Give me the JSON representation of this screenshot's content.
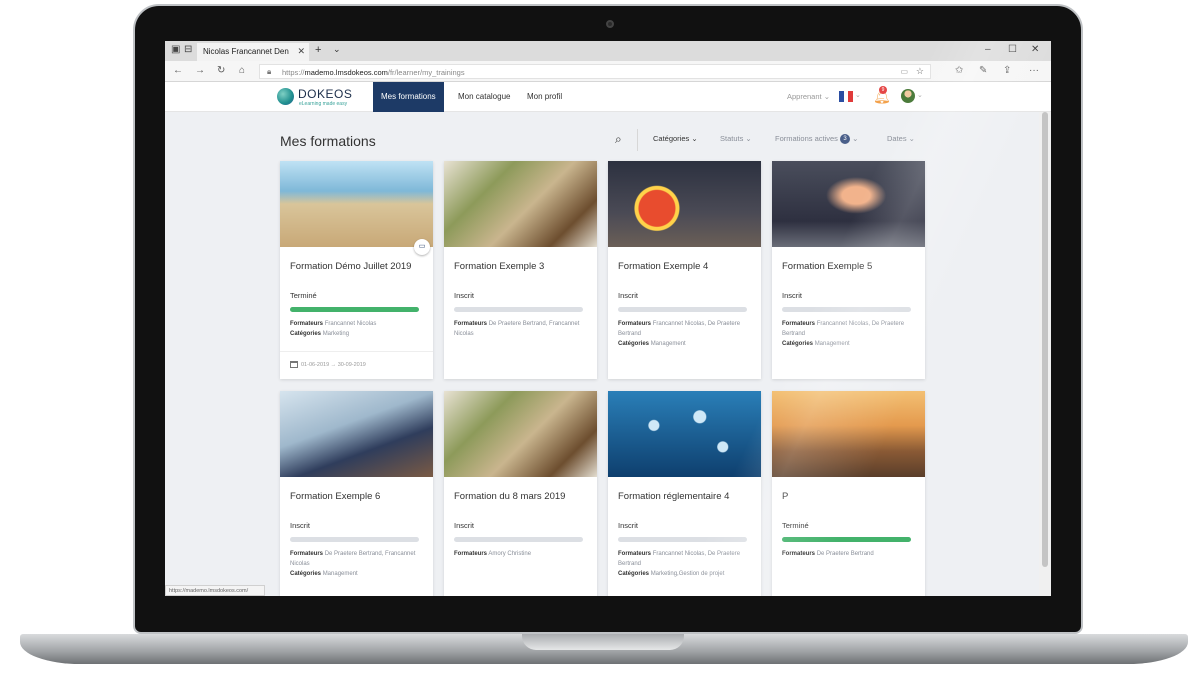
{
  "browser": {
    "tab_title": "Nicolas Francannet Den",
    "tab_close": "✕",
    "new_tab": "+",
    "tab_menu": "⌄",
    "url_prefix": "https://",
    "url_host": "mademo.lmsdokeos.com",
    "url_path": "/fr/learner/my_trainings",
    "status_url": "https://mademo.lmsdokeos.com/",
    "icons": [
      "tab-actions-icon",
      "back-icon",
      "forward-icon",
      "refresh-icon",
      "home-icon",
      "lock-icon",
      "reading-view-icon",
      "favorite-star-icon",
      "favorites-icon",
      "pen-icon",
      "share-icon",
      "more-icon",
      "minimize-icon",
      "maximize-icon",
      "close-window-icon"
    ]
  },
  "header": {
    "logo_name": "DOKEOS",
    "logo_tagline": "eLearning made easy",
    "nav": [
      {
        "label": "Mes formations"
      },
      {
        "label": "Mon catalogue"
      },
      {
        "label": "Mon profil"
      }
    ],
    "role": "Apprenant ⌄",
    "notification_count": "9",
    "flag_colors": [
      "#2b4ea2",
      "#ffffff",
      "#e03b3b"
    ]
  },
  "main": {
    "title": "Mes formations",
    "filters": {
      "categories": "Catégories ⌄",
      "statuts": "Statuts ⌄",
      "active_label": "Formations actives",
      "active_count": "3",
      "active_caret": "⌄",
      "dates": "Dates ⌄"
    }
  },
  "cards": [
    {
      "title": "Formation Démo Juillet 2019",
      "status": "Terminé",
      "progress": 1.0,
      "formateurs_label": "Formateurs",
      "formateurs": "Francannet Nicolas",
      "categories_label": "Catégories",
      "categories": "Marketing",
      "dates": "01-06-2019 → 30-09-2019"
    },
    {
      "title": "Formation Exemple 3",
      "status": "Inscrit",
      "progress": 0.0,
      "formateurs_label": "Formateurs",
      "formateurs": "De Praetere Bertrand, Francannet Nicolas"
    },
    {
      "title": "Formation Exemple 4",
      "status": "Inscrit",
      "progress": 0.0,
      "formateurs_label": "Formateurs",
      "formateurs": "Francannet Nicolas, De Praetere Bertrand",
      "categories_label": "Catégories",
      "categories": "Management"
    },
    {
      "title": "Formation Exemple 5",
      "status": "Inscrit",
      "progress": 0.0,
      "formateurs_label": "Formateurs",
      "formateurs": "Francannet Nicolas, De Praetere Bertrand",
      "categories_label": "Catégories",
      "categories": "Management"
    },
    {
      "title": "Formation Exemple 6",
      "status": "Inscrit",
      "progress": 0.0,
      "formateurs_label": "Formateurs",
      "formateurs": "De Praetere Bertrand, Francannet Nicolas",
      "categories_label": "Catégories",
      "categories": "Management"
    },
    {
      "title": "Formation du 8 mars 2019",
      "status": "Inscrit",
      "progress": 0.0,
      "formateurs_label": "Formateurs",
      "formateurs": "Amory Christine"
    },
    {
      "title": "Formation réglementaire 4",
      "status": "Inscrit",
      "progress": 0.0,
      "formateurs_label": "Formateurs",
      "formateurs": "Francannet Nicolas, De Praetere Bertrand",
      "categories_label": "Catégories",
      "categories": "Marketing,Gestion de projet"
    },
    {
      "title": "P",
      "status": "Terminé",
      "progress": 1.0,
      "formateurs_label": "Formateurs",
      "formateurs": "De Praetere Bertrand"
    }
  ],
  "colors": {
    "nav_active": "#1d3a66",
    "progress_done": "#43b26b",
    "progress_track": "#dcdfe4"
  }
}
